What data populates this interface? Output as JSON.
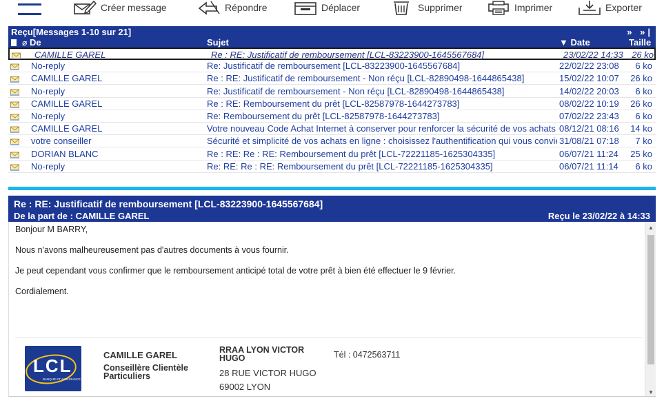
{
  "toolbar": {
    "buttons": [
      {
        "label": "Créer message",
        "icon": "compose-icon"
      },
      {
        "label": "Répondre",
        "icon": "reply-icon"
      },
      {
        "label": "Déplacer",
        "icon": "move-icon"
      },
      {
        "label": "Supprimer",
        "icon": "trash-icon"
      },
      {
        "label": "Imprimer",
        "icon": "printer-icon"
      },
      {
        "label": "Exporter",
        "icon": "export-icon"
      }
    ]
  },
  "list": {
    "title": "Reçu",
    "counter": "[Messages 1-10 sur 21]",
    "pager": "» »|",
    "columns": {
      "from": "De",
      "subject": "Sujet",
      "date": "Date",
      "size": "Taille"
    },
    "rows": [
      {
        "from": "CAMILLE GAREL",
        "subject": "Re : RE: Justificatif de remboursement [LCL-83223900-1645567684]",
        "date": "23/02/22 14:33",
        "size": "26 ko"
      },
      {
        "from": "No-reply",
        "subject": "Re: Justificatif de remboursement [LCL-83223900-1645567684]",
        "date": "22/02/22 23:08",
        "size": "6 ko"
      },
      {
        "from": "CAMILLE GAREL",
        "subject": "Re : RE: Justificatif de remboursement - Non réçu [LCL-82890498-1644865438]",
        "date": "15/02/22 10:07",
        "size": "26 ko"
      },
      {
        "from": "No-reply",
        "subject": "Re: Justificatif de remboursement - Non réçu [LCL-82890498-1644865438]",
        "date": "14/02/22 20:03",
        "size": "6 ko"
      },
      {
        "from": "CAMILLE GAREL",
        "subject": "Re : RE: Remboursement du prêt [LCL-82587978-1644273783]",
        "date": "08/02/22 10:19",
        "size": "26 ko"
      },
      {
        "from": "No-reply",
        "subject": "Re: Remboursement du prêt [LCL-82587978-1644273783]",
        "date": "07/02/22 23:43",
        "size": "6 ko"
      },
      {
        "from": "CAMILLE GAREL",
        "subject": "Votre nouveau Code Achat Internet à conserver pour renforcer la sécurité de vos achats",
        "date": "08/12/21 08:16",
        "size": "14 ko"
      },
      {
        "from": "votre conseiller",
        "subject": "Sécurité et simplicité de vos achats en ligne : choisissez l'authentification qui vous convie",
        "date": "31/08/21 07:18",
        "size": "7 ko"
      },
      {
        "from": "DORIAN BLANC",
        "subject": "Re : RE: Re : RE: Remboursement du prêt [LCL-72221185-1625304335]",
        "date": "06/07/21 11:24",
        "size": "25 ko"
      },
      {
        "from": "No-reply",
        "subject": "Re: RE: Re : RE: Remboursement du prêt [LCL-72221185-1625304335]",
        "date": "06/07/21 11:14",
        "size": "6 ko"
      }
    ]
  },
  "message": {
    "subject": "Re : RE: Justificatif de remboursement [LCL-83223900-1645567684]",
    "from": "De la part de : CAMILLE GAREL",
    "received": "Reçu le 23/02/22 à 14:33",
    "body": [
      "Bonjour M BARRY,",
      "Nous n'avons malheureusement pas d'autres documents à vous fournir.",
      "Je peut cependant vous confirmer que le remboursement anticipé total de votre prêt à bien été effectuer le 9 février.",
      "Cordialement."
    ],
    "signature": {
      "logo_text": "LCL",
      "logo_subtext": "BANQUE ET ASSURANCE",
      "name": "CAMILLE GAREL",
      "role": "Conseillère Clientèle Particuliers",
      "agency": "RRAA LYON VICTOR HUGO",
      "street": "28 RUE VICTOR HUGO",
      "city": "69002 LYON",
      "phone": "Tél : 0472563711"
    }
  },
  "colors": {
    "header_blue": "#1d3794",
    "separator_cyan": "#19b7ea",
    "link_blue": "#1e3da0"
  }
}
